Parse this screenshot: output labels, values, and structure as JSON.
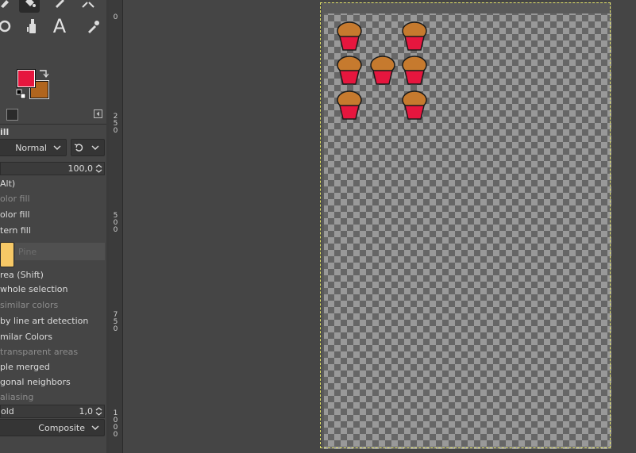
{
  "tool_options": {
    "title": "ill",
    "mode_value": "Normal",
    "opacity_value": "100,0",
    "fill_type_header": "Alt)",
    "fg_fill": "olor fill",
    "bg_fill": "olor fill",
    "pattern_fill": "tern fill",
    "pattern_name": "Pine",
    "affected_area_header": "rea  (Shift)",
    "fill_whole": "whole selection",
    "fill_similar": "similar colors",
    "fill_lineart": "by line art detection",
    "similar_colors_header": "milar Colors",
    "fill_transparent": "transparent areas",
    "sample_merged": "ple merged",
    "diagonal": "gonal neighbors",
    "antialias": "aliasing",
    "threshold_label": "old",
    "threshold_value": "1,0",
    "fill_by_value": "Composite"
  },
  "colors": {
    "foreground": "#e6163e",
    "background": "#b0651e"
  },
  "ruler_labels": [
    "0",
    "2\n5\n0",
    "5\n0\n0",
    "7\n5\n0",
    "1\n0\n0\n0"
  ],
  "icons": [
    "smudge-icon",
    "bucket-fill-icon",
    "paintbrush-icon",
    "heal-icon",
    "clone-icon",
    "text-icon",
    "color-picker-icon",
    "swap-colors-icon",
    "default-colors-icon"
  ]
}
